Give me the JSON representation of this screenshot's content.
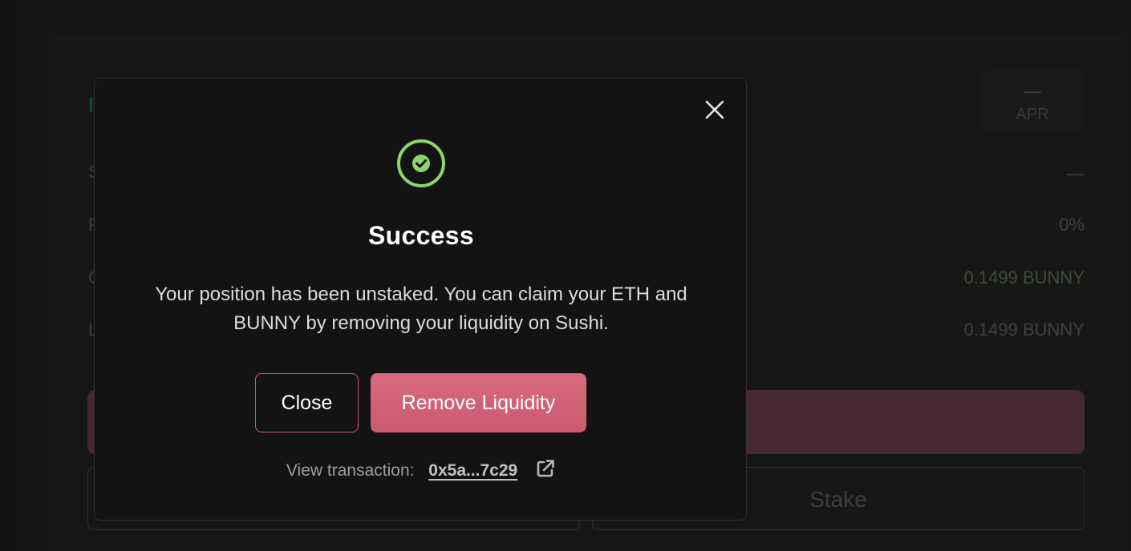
{
  "background": {
    "title_initial": "I",
    "apr_value": "—",
    "apr_label": "APR",
    "rows": [
      {
        "label": "S",
        "value": "—"
      },
      {
        "label": "P",
        "value": "0%"
      },
      {
        "label": "C",
        "value": "0.1499 BUNNY"
      },
      {
        "label": "L",
        "value": "0.1499 BUNNY"
      }
    ],
    "stake_label": "Stake"
  },
  "modal": {
    "title": "Success",
    "message": "Your position has been unstaked. You can claim your ETH and BUNNY by removing your liquidity on Sushi.",
    "close_label": "Close",
    "remove_label": "Remove Liquidity",
    "tx_label": "View transaction:",
    "tx_hash": "0x5a...7c29",
    "icons": {
      "success": "check-circle-icon",
      "close": "close-icon",
      "external": "external-link-icon"
    }
  },
  "colors": {
    "accent": "#d9697e",
    "success": "#8fd46b",
    "modal_bg": "#131314"
  }
}
